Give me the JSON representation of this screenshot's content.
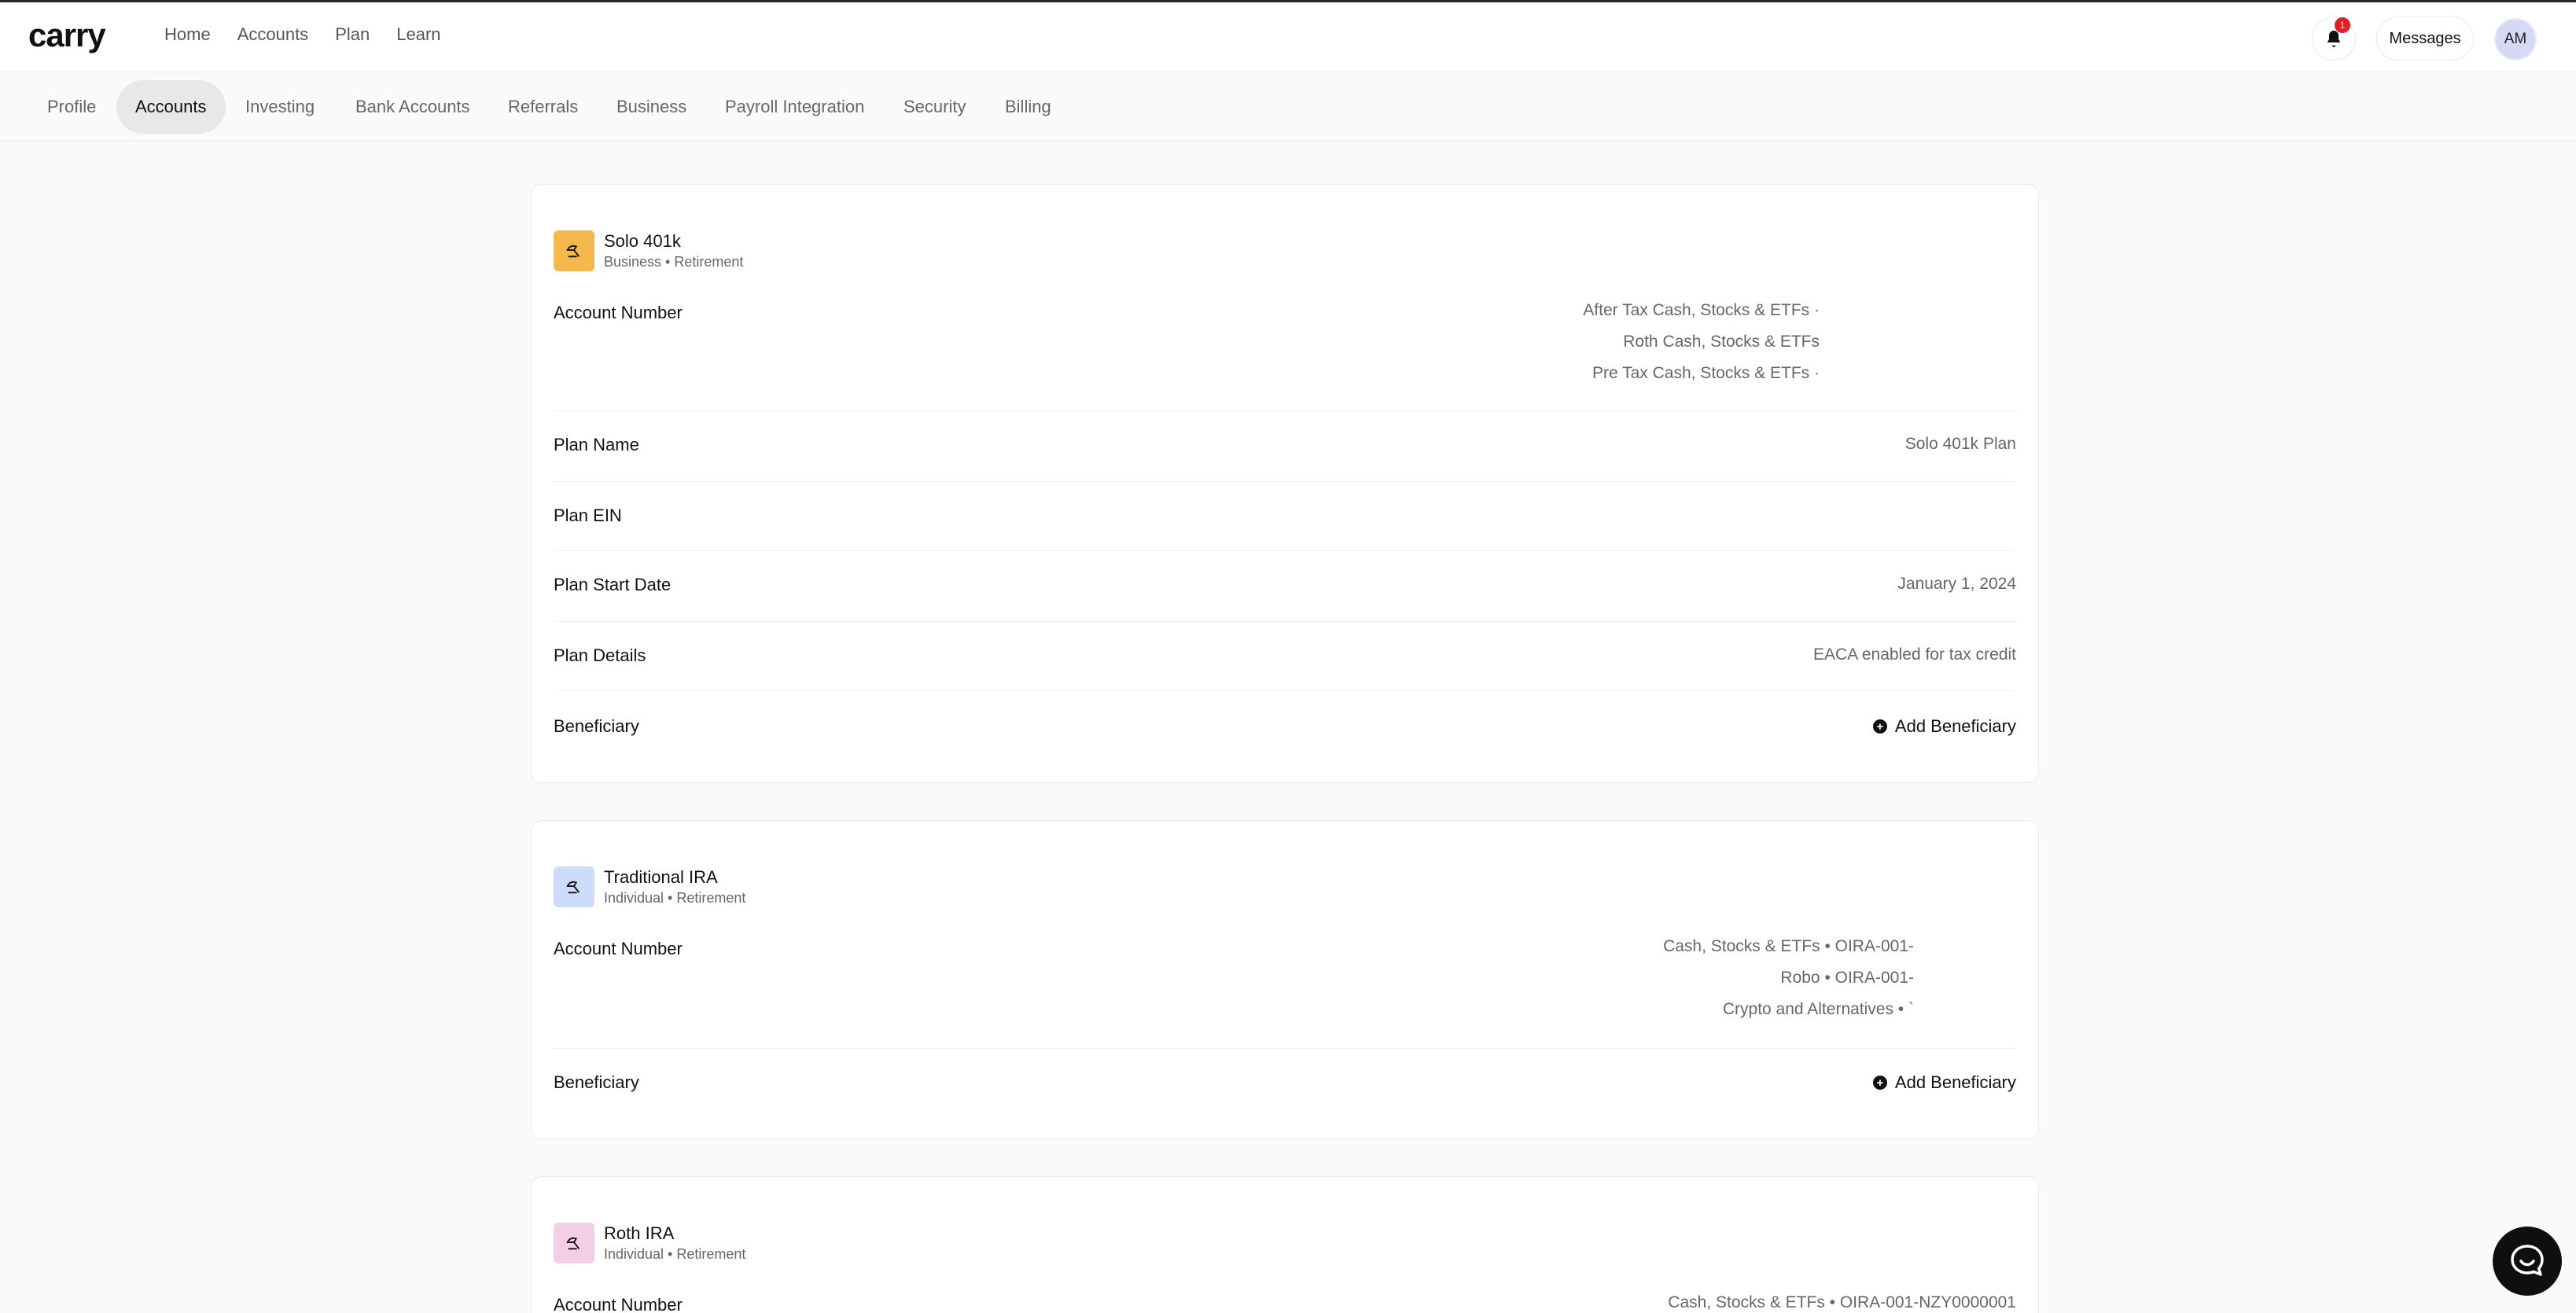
{
  "app": {
    "logo": "carry"
  },
  "nav": {
    "items": [
      "Home",
      "Accounts",
      "Plan",
      "Learn"
    ]
  },
  "header": {
    "notification_count": "1",
    "messages_label": "Messages",
    "avatar_initials": "AM"
  },
  "subnav": {
    "tabs": [
      "Profile",
      "Accounts",
      "Investing",
      "Bank Accounts",
      "Referrals",
      "Business",
      "Payroll Integration",
      "Security",
      "Billing"
    ],
    "active": "Accounts"
  },
  "accounts": [
    {
      "title": "Solo 401k",
      "subtitle": "Business • Retirement",
      "icon": "umbrella-beach-icon",
      "icon_bg": "#f6b84a",
      "account_number_label": "Account Number",
      "account_numbers": [
        "After Tax Cash, Stocks & ETFs ·",
        "Roth Cash, Stocks & ETFs",
        "Pre Tax Cash, Stocks & ETFs ·"
      ],
      "rows": [
        {
          "label": "Plan Name",
          "value": "Solo 401k Plan"
        },
        {
          "label": "Plan EIN",
          "value": ""
        },
        {
          "label": "Plan Start Date",
          "value": "January 1, 2024"
        },
        {
          "label": "Plan Details",
          "value": "EACA enabled for tax credit"
        }
      ],
      "beneficiary_label": "Beneficiary",
      "add_beneficiary_label": "Add Beneficiary"
    },
    {
      "title": "Traditional IRA",
      "subtitle": "Individual • Retirement",
      "icon": "umbrella-beach-icon",
      "icon_bg": "#cddcfb",
      "account_number_label": "Account Number",
      "account_numbers": [
        "Cash, Stocks & ETFs • OIRA-001-",
        "Robo • OIRA-001-",
        "Crypto and Alternatives • `"
      ],
      "beneficiary_label": "Beneficiary",
      "add_beneficiary_label": "Add Beneficiary"
    },
    {
      "title": "Roth IRA",
      "subtitle": "Individual • Retirement",
      "icon": "umbrella-beach-icon",
      "icon_bg": "#f2cfe6",
      "account_number_label": "Account Number",
      "account_numbers": [
        "Cash, Stocks & ETFs • OIRA-001-NZY0000001"
      ]
    }
  ]
}
